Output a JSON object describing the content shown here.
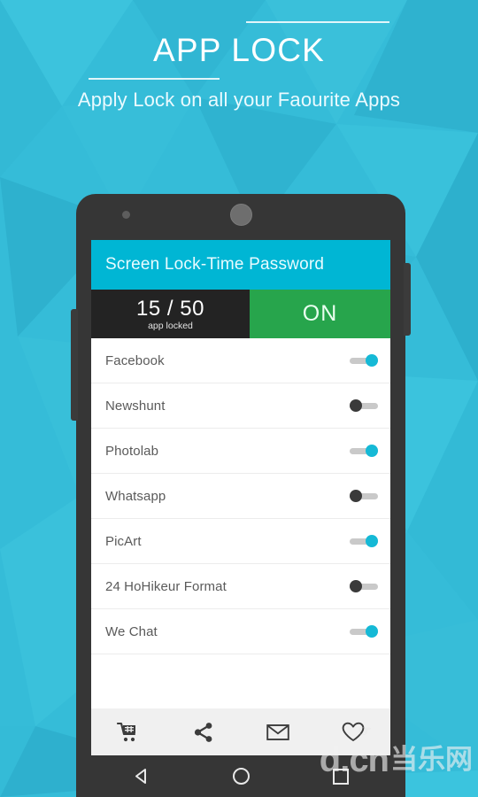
{
  "promo": {
    "title": "APP LOCK",
    "subtitle": "Apply Lock on all your Faourite Apps",
    "bg_color": "#35bcd8",
    "title_color": "#ffffff"
  },
  "phone": {
    "body_color": "#363636",
    "hardware": {
      "sensor": "sensor-dot",
      "speaker": "earpiece-speaker",
      "volume_button": "volume-rocker",
      "power_button": "power-button"
    }
  },
  "app": {
    "appbar": {
      "title": "Screen Lock-Time Password",
      "color": "#00b6d4"
    },
    "stats": {
      "count": "15 / 50",
      "caption": "app locked",
      "toggle_label": "ON",
      "left_bg": "#232323",
      "right_bg": "#27a54c"
    },
    "list": [
      {
        "name": "Facebook",
        "locked": true,
        "toggle_state": "on"
      },
      {
        "name": "Newshunt",
        "locked": false,
        "toggle_state": "off"
      },
      {
        "name": "Photolab",
        "locked": true,
        "toggle_state": "on"
      },
      {
        "name": "Whatsapp",
        "locked": false,
        "toggle_state": "off"
      },
      {
        "name": "PicArt",
        "locked": true,
        "toggle_state": "on"
      },
      {
        "name": "24 HoHikeur Format",
        "locked": false,
        "toggle_state": "off"
      },
      {
        "name": "We Chat",
        "locked": true,
        "toggle_state": "on"
      }
    ],
    "toolbar": [
      {
        "icon": "shopping-cart-icon"
      },
      {
        "icon": "share-icon"
      },
      {
        "icon": "envelope-icon"
      },
      {
        "icon": "heart-icon"
      }
    ],
    "toggle_colors": {
      "on": "#15b9d6",
      "off": "#3a3a3a",
      "track": "#c9c9c9"
    }
  },
  "navbar": {
    "items": [
      {
        "icon": "back-triangle-icon"
      },
      {
        "icon": "home-circle-icon"
      },
      {
        "icon": "recents-square-icon"
      }
    ]
  },
  "watermark": {
    "latin": "d.cn",
    "cjk": "当乐网"
  }
}
